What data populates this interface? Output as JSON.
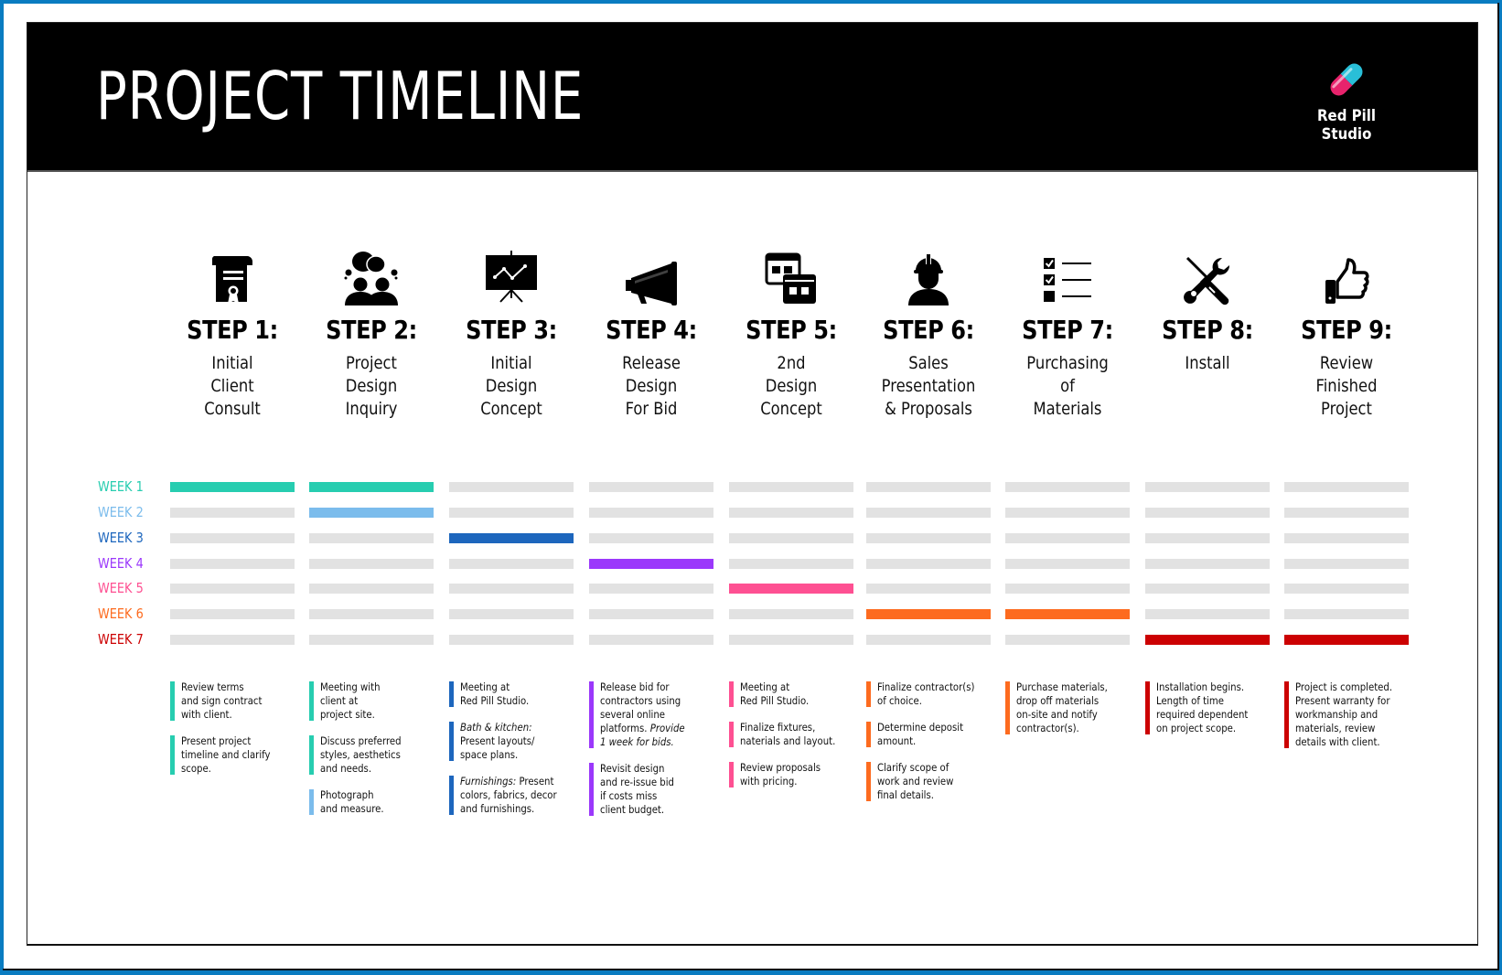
{
  "header": {
    "title": "PROJECT TIMELINE",
    "brand_name": "Red Pill Studio",
    "brand_icon": "pill-capsule-icon",
    "brand_colors": {
      "pink": "#e8236c",
      "cyan": "#29bfd8"
    }
  },
  "steps": [
    {
      "label": "STEP 1:",
      "name": "Initial\nClient\nConsult",
      "icon": "certificate-scroll-icon"
    },
    {
      "label": "STEP 2:",
      "name": "Project\nDesign\nInquiry",
      "icon": "people-discussion-icon"
    },
    {
      "label": "STEP 3:",
      "name": "Initial\nDesign\nConcept",
      "icon": "presentation-board-icon"
    },
    {
      "label": "STEP 4:",
      "name": "Release\nDesign\nFor Bid",
      "icon": "megaphone-icon"
    },
    {
      "label": "STEP 5:",
      "name": "2nd\nDesign\nConcept",
      "icon": "layout-windows-icon"
    },
    {
      "label": "STEP 6:",
      "name": "Sales\nPresentation\n& Proposals",
      "icon": "construction-worker-icon"
    },
    {
      "label": "STEP 7:",
      "name": "Purchasing\nof\nMaterials",
      "icon": "checklist-icon"
    },
    {
      "label": "STEP 8:",
      "name": "Install",
      "icon": "tools-wrench-screwdriver-icon"
    },
    {
      "label": "STEP 9:",
      "name": "Review\nFinished\nProject",
      "icon": "thumbs-up-icon"
    }
  ],
  "weeks": [
    {
      "label": "WEEK 1",
      "color": "#27cdb0"
    },
    {
      "label": "WEEK 2",
      "color": "#7bbcec"
    },
    {
      "label": "WEEK 3",
      "color": "#1d66bd"
    },
    {
      "label": "WEEK 4",
      "color": "#9b38fb"
    },
    {
      "label": "WEEK 5",
      "color": "#fe5092"
    },
    {
      "label": "WEEK 6",
      "color": "#fd6b1f"
    },
    {
      "label": "WEEK 7",
      "color": "#cc0102"
    }
  ],
  "empty_bar_color": "#e2e2e2",
  "schedule": [
    {
      "step": 1,
      "weeks": [
        1
      ]
    },
    {
      "step": 2,
      "weeks": [
        1,
        2
      ]
    },
    {
      "step": 3,
      "weeks": [
        3
      ]
    },
    {
      "step": 4,
      "weeks": [
        4
      ]
    },
    {
      "step": 5,
      "weeks": [
        5
      ]
    },
    {
      "step": 6,
      "weeks": [
        6
      ]
    },
    {
      "step": 7,
      "weeks": [
        6
      ]
    },
    {
      "step": 8,
      "weeks": [
        7
      ]
    },
    {
      "step": 9,
      "weeks": [
        7
      ]
    }
  ],
  "notes": [
    [
      {
        "week": 1,
        "html": "Review terms\n and sign contract\nwith client."
      },
      {
        "week": 1,
        "html": "Present project\ntimeline and clarify\nscope."
      }
    ],
    [
      {
        "week": 1,
        "html": "Meeting with\nclient at\nproject site."
      },
      {
        "week": 1,
        "html": "Discuss preferred\nstyles, aesthetics\nand needs."
      },
      {
        "week": 2,
        "html": "Photograph\nand measure."
      }
    ],
    [
      {
        "week": 3,
        "html": "Meeting at\nRed Pill Studio."
      },
      {
        "week": 3,
        "html": "<i>Bath &amp; kitchen:</i>\nPresent layouts/\nspace plans."
      },
      {
        "week": 3,
        "html": "<i>Furnishings:</i> Present\ncolors, fabrics, decor\nand furnishings."
      }
    ],
    [
      {
        "week": 4,
        "html": "Release bid for\ncontractors using\nseveral online\nplatforms. <i>Provide\n1 week for bids.</i>"
      },
      {
        "week": 4,
        "html": "Revisit design\nand re-issue bid\nif costs miss\nclient budget."
      }
    ],
    [
      {
        "week": 5,
        "html": "Meeting at\nRed Pill Studio."
      },
      {
        "week": 5,
        "html": "Finalize fixtures,\nnaterials and layout."
      },
      {
        "week": 5,
        "html": "Review proposals\nwith pricing."
      }
    ],
    [
      {
        "week": 6,
        "html": "Finalize contractor(s)\nof choice."
      },
      {
        "week": 6,
        "html": "Determine deposit\namount."
      },
      {
        "week": 6,
        "html": "Clarify scope of\nwork and review\nfinal details."
      }
    ],
    [
      {
        "week": 6,
        "html": "Purchase materials,\ndrop off materials\non-site and notify\ncontractor(s)."
      }
    ],
    [
      {
        "week": 7,
        "html": "Installation begins.\nLength of time\nrequired dependent\non project scope."
      }
    ],
    [
      {
        "week": 7,
        "html": "Project is completed.\nPresent warranty for\nworkmanship and\nmaterials, review\ndetails with client."
      }
    ]
  ]
}
